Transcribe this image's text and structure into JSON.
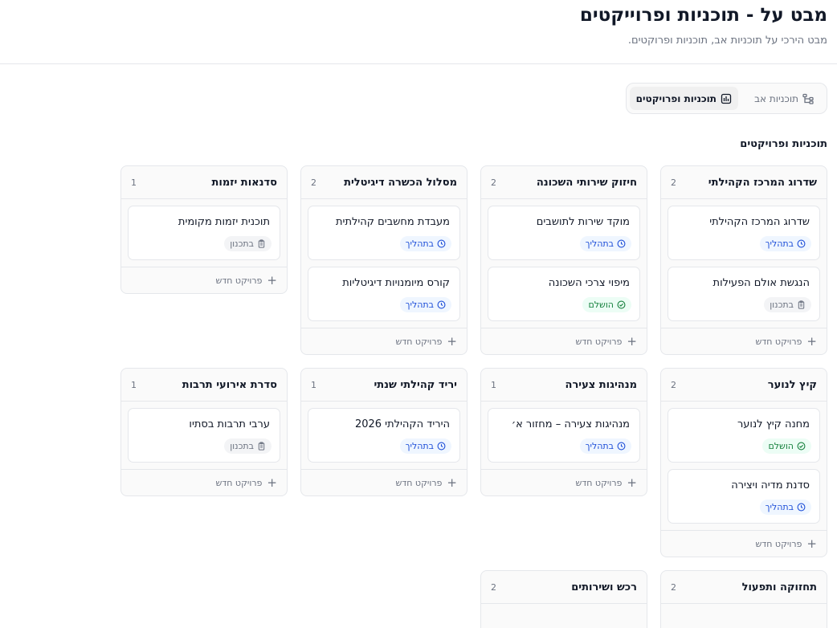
{
  "header": {
    "title": "מבט על - תוכניות ופרוייקטים",
    "subtitle": "מבט הירכי על תוכניות אב, תוכניות ופרוקטים."
  },
  "view_toggle": {
    "active_label": "תוכניות ופרויקטים",
    "inactive_label": "תוכניות אב"
  },
  "section_title": "תוכניות ופרויקטים",
  "new_project_label": "פרויקט חדש",
  "status_labels": {
    "progress": "בתהליך",
    "done": "הושלם",
    "planned": "בתכנון"
  },
  "status_colors": {
    "progress": "#1d4ed8",
    "done": "#15803d",
    "planned": "#6b7280"
  },
  "programs": [
    {
      "title": "שדרוג המרכז הקהילתי",
      "count": "2",
      "projects": [
        {
          "name": "שדרוג המרכז הקהילתי",
          "status": "progress"
        },
        {
          "name": "הנגשת אולם הפעילות",
          "status": "planned"
        }
      ]
    },
    {
      "title": "חיזוק שירותי השכונה",
      "count": "2",
      "projects": [
        {
          "name": "מוקד שירות לתושבים",
          "status": "progress"
        },
        {
          "name": "מיפוי צרכי השכונה",
          "status": "done"
        }
      ]
    },
    {
      "title": "מסלול הכשרה דיגיטלית",
      "count": "2",
      "projects": [
        {
          "name": "מעבדת מחשבים קהילתית",
          "status": "progress"
        },
        {
          "name": "קורס מיומנויות דיגיטליות",
          "status": "progress"
        }
      ]
    },
    {
      "title": "סדנאות יזמות",
      "count": "1",
      "projects": [
        {
          "name": "תוכנית יזמות מקומית",
          "status": "planned"
        }
      ]
    },
    {
      "title": "קיץ לנוער",
      "count": "2",
      "projects": [
        {
          "name": "מחנה קיץ לנוער",
          "status": "done"
        },
        {
          "name": "סדנת מדיה ויצירה",
          "status": "progress"
        }
      ]
    },
    {
      "title": "מנהיגות צעירה",
      "count": "1",
      "projects": [
        {
          "name": "מנהיגות צעירה – מחזור א׳",
          "status": "progress"
        }
      ]
    },
    {
      "title": "יריד קהילתי שנתי",
      "count": "1",
      "projects": [
        {
          "name": "היריד הקהילתי 2026",
          "status": "progress"
        }
      ]
    },
    {
      "title": "סדרת אירועי תרבות",
      "count": "1",
      "projects": [
        {
          "name": "ערבי תרבות בסתיו",
          "status": "planned"
        }
      ]
    },
    {
      "title": "תחזוקה ותפעול",
      "count": "2",
      "projects": []
    },
    {
      "title": "רכש ושירותים",
      "count": "2",
      "projects": []
    }
  ]
}
